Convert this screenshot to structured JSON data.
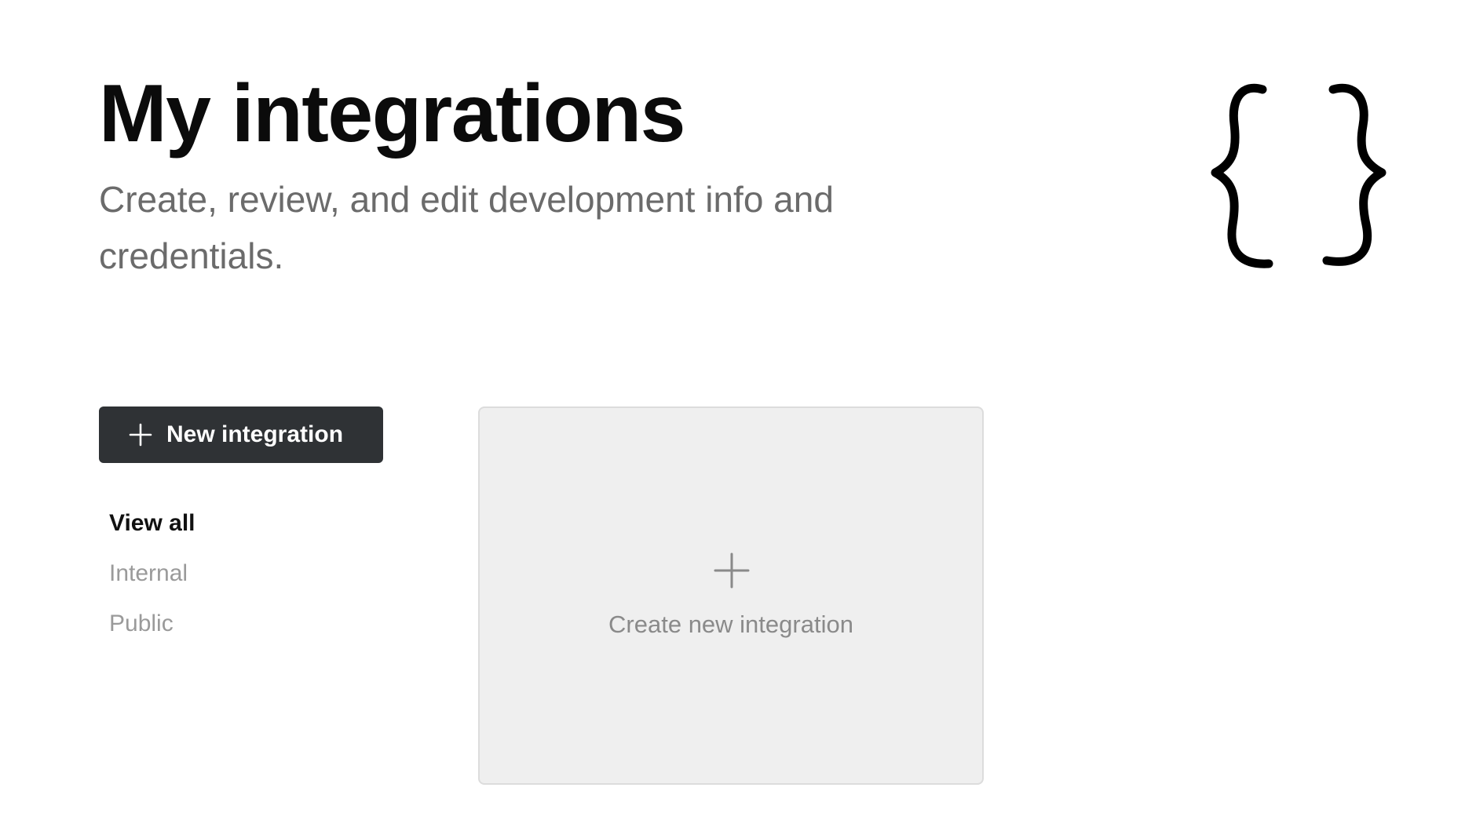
{
  "header": {
    "title": "My integrations",
    "subtitle": "Create, review, and edit development info and credentials."
  },
  "illustration": {
    "icon": "curly-braces-icon"
  },
  "sidebar": {
    "new_button": {
      "label": "New integration",
      "icon": "plus-icon"
    },
    "filters": [
      {
        "label": "View all",
        "active": true
      },
      {
        "label": "Internal",
        "active": false
      },
      {
        "label": "Public",
        "active": false
      }
    ]
  },
  "main": {
    "create_card": {
      "label": "Create new integration",
      "icon": "plus-icon"
    }
  },
  "colors": {
    "button_bg": "#2f3235",
    "card_bg": "#efefef",
    "subtitle_text": "#6b6b6b",
    "muted_text": "#9a9a9a"
  }
}
